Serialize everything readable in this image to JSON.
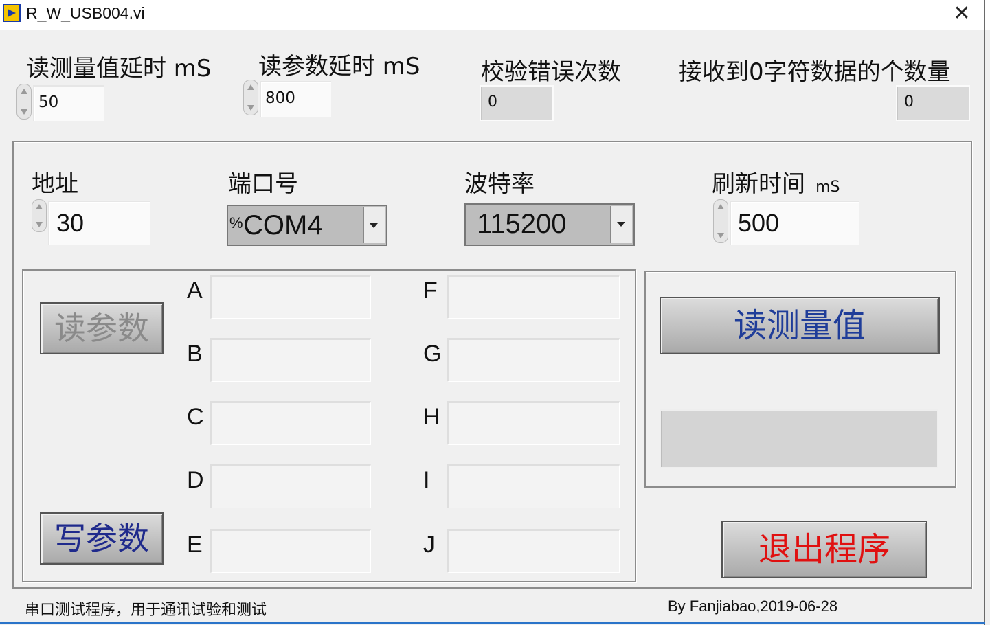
{
  "window": {
    "title": "R_W_USB004.vi",
    "close_glyph": "✕",
    "icon": "labview-vi-icon"
  },
  "top": {
    "read_measure_delay": {
      "label": "读测量值延时 mS",
      "value": "50"
    },
    "read_param_delay": {
      "label": "读参数延时  mS",
      "value": "800"
    },
    "checksum_errors": {
      "label": "校验错误次数",
      "value": "0"
    },
    "zero_char_count": {
      "label": "接收到0字符数据的个数量",
      "value": "0"
    }
  },
  "settings": {
    "address": {
      "label": "地址",
      "value": "30"
    },
    "port": {
      "label": "端口号",
      "value": "COM4",
      "prefix": "%"
    },
    "baud": {
      "label": "波特率",
      "value": "115200"
    },
    "refresh": {
      "label": "刷新时间",
      "unit": "mS",
      "value": "500"
    }
  },
  "params": {
    "read_button": "读参数",
    "write_button": "写参数",
    "fields": [
      {
        "letter": "A",
        "value": ""
      },
      {
        "letter": "B",
        "value": ""
      },
      {
        "letter": "C",
        "value": ""
      },
      {
        "letter": "D",
        "value": ""
      },
      {
        "letter": "E",
        "value": ""
      },
      {
        "letter": "F",
        "value": ""
      },
      {
        "letter": "G",
        "value": ""
      },
      {
        "letter": "H",
        "value": ""
      },
      {
        "letter": "I",
        "value": ""
      },
      {
        "letter": "J",
        "value": ""
      }
    ]
  },
  "measure": {
    "read_button": "读测量值",
    "display": ""
  },
  "exit_button": "退出程序",
  "footer": {
    "description": "串口测试程序，用于通讯试验和测试",
    "credit": "By Fanjiabao,2019-06-28"
  },
  "colors": {
    "read_measure_text": "#1f3d99",
    "write_param_text": "#1f2a8c",
    "exit_text": "#e01010",
    "read_param_text": "#8a8a8a"
  }
}
